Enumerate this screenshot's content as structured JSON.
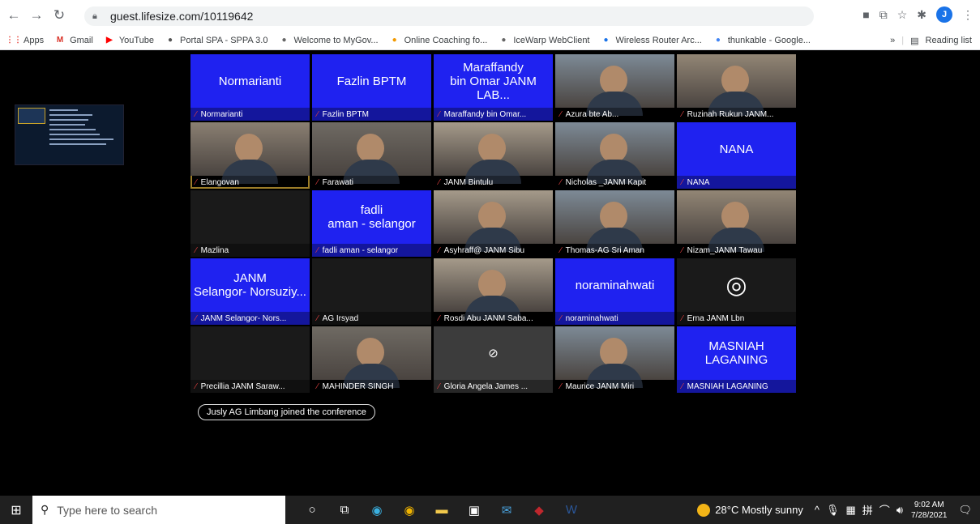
{
  "browser": {
    "url": "guest.lifesize.com/10119642",
    "profile_initial": "J"
  },
  "bookmarks": [
    {
      "label": "Apps",
      "icon": "apps-grid-icon",
      "color": "#e8453c"
    },
    {
      "label": "Gmail",
      "icon": "gmail-icon",
      "color": "#d93025"
    },
    {
      "label": "YouTube",
      "icon": "youtube-icon",
      "color": "#ff0000"
    },
    {
      "label": "Portal SPA - SPPA 3.0",
      "icon": "globe-icon",
      "color": "#555"
    },
    {
      "label": "Welcome to MyGov...",
      "icon": "mygov-icon",
      "color": "#666"
    },
    {
      "label": "Online Coaching fo...",
      "icon": "coaching-icon",
      "color": "#f29900"
    },
    {
      "label": "IceWarp WebClient",
      "icon": "icewarp-icon",
      "color": "#666"
    },
    {
      "label": "Wireless Router Arc...",
      "icon": "tplink-icon",
      "color": "#1a73e8"
    },
    {
      "label": "thunkable - Google...",
      "icon": "google-icon",
      "color": "#4285f4"
    }
  ],
  "bookmarks_right": {
    "more": "»",
    "reading_list": "Reading list"
  },
  "participants": [
    {
      "tile": "Normarianti",
      "label": "Normarianti",
      "style": "blue"
    },
    {
      "tile": "Fazlin BPTM",
      "label": "Fazlin BPTM",
      "style": "blue"
    },
    {
      "tile": "Maraffandy\nbin Omar JANM LAB...",
      "label": "Maraffandy bin Omar...",
      "style": "blue"
    },
    {
      "tile": "",
      "label": "Azura bte Ab...",
      "style": "video"
    },
    {
      "tile": "",
      "label": "Ruzinah Rukun JANM...",
      "style": "video"
    },
    {
      "tile": "",
      "label": "Elangovan",
      "style": "video-active"
    },
    {
      "tile": "",
      "label": "Farawati",
      "style": "video"
    },
    {
      "tile": "",
      "label": "JANM Bintulu",
      "style": "video"
    },
    {
      "tile": "",
      "label": "Nicholas _JANM Kapit",
      "style": "video"
    },
    {
      "tile": "NANA",
      "label": "NANA",
      "style": "blue"
    },
    {
      "tile": "",
      "label": "Mazlina",
      "style": "dark"
    },
    {
      "tile": "fadli\naman - selangor",
      "label": "fadli aman - selangor",
      "style": "blue"
    },
    {
      "tile": "",
      "label": "Asyhraff@ JANM Sibu",
      "style": "video"
    },
    {
      "tile": "",
      "label": "Thomas-AG Sri Aman",
      "style": "video"
    },
    {
      "tile": "",
      "label": "Nizam_JANM Tawau",
      "style": "video"
    },
    {
      "tile": "JANM\nSelangor- Norsuziy...",
      "label": "JANM Selangor- Nors...",
      "style": "blue"
    },
    {
      "tile": "",
      "label": "AG Irsyad",
      "style": "dark"
    },
    {
      "tile": "",
      "label": "Rosdi Abu JANM Saba...",
      "style": "video"
    },
    {
      "tile": "noraminahwati",
      "label": "noraminahwati",
      "style": "blue"
    },
    {
      "tile": "",
      "label": "Erna JANM Lbn",
      "style": "obs"
    },
    {
      "tile": "",
      "label": "Precillia JANM Saraw...",
      "style": "dark"
    },
    {
      "tile": "",
      "label": "MAHINDER SINGH",
      "style": "video"
    },
    {
      "tile": "",
      "label": "Gloria Angela James ...",
      "style": "camoff"
    },
    {
      "tile": "",
      "label": "Maurice JANM Miri",
      "style": "video"
    },
    {
      "tile": "MASNIAH LAGANING",
      "label": "MASNIAH LAGANING",
      "style": "blue"
    }
  ],
  "toast": "Jusly AG Limbang joined the conference",
  "taskbar": {
    "search_placeholder": "Type here to search",
    "weather": "28°C  Mostly sunny",
    "time": "9:02 AM",
    "date": "7/28/2021"
  }
}
